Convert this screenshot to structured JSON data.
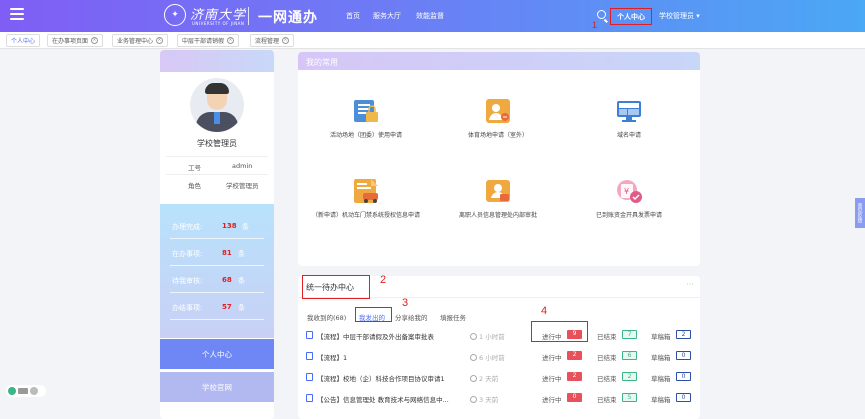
{
  "header": {
    "school_name": "济南大学",
    "school_name_en": "UNIVERSITY OF JINAN",
    "app_title": "一网通办",
    "nav": [
      "首页",
      "服务大厅",
      "效能监督"
    ],
    "personal_center": "个人中心",
    "admin_menu": "学校管理员 ▾",
    "annotation": "1"
  },
  "tabs": [
    "个人中心",
    "在办事项页面",
    "业务管理中心",
    "中层干部请销假",
    "流程管理"
  ],
  "profile": {
    "name": "学校管理员",
    "rows": [
      {
        "label": "工号",
        "value": "admin"
      },
      {
        "label": "角色",
        "value": "学校管理员"
      }
    ],
    "stats": [
      {
        "label": "办理完成:",
        "value": "138",
        "unit": "条"
      },
      {
        "label": "在办事项:",
        "value": "81",
        "unit": "条"
      },
      {
        "label": "待我审核:",
        "value": "68",
        "unit": "条"
      },
      {
        "label": "办结事项:",
        "value": "57",
        "unit": "条"
      }
    ],
    "menu": [
      "个人中心",
      "学校官网"
    ]
  },
  "favorites": {
    "title": "我的常用",
    "apps": [
      {
        "label": "活动场地（团委）使用申请",
        "icon": "building-lock-icon"
      },
      {
        "label": "体育场地申请（室外）",
        "icon": "person-doc-icon"
      },
      {
        "label": "域名申请",
        "icon": "monitor-icon"
      },
      {
        "label": "（新申请）机动车门禁系统授权信息申请",
        "icon": "car-doc-icon"
      },
      {
        "label": "离职人员信息管理处内部审批",
        "icon": "person-card-icon"
      },
      {
        "label": "已到账资金开具发票申请",
        "icon": "invoice-icon"
      }
    ]
  },
  "todo": {
    "title": "统一待办中心",
    "annotation_2": "2",
    "annotation_3": "3",
    "annotation_4": "4",
    "filters": [
      "我收到的(68)",
      "我发出的",
      "分享给我的",
      "填报任务"
    ],
    "rows": [
      {
        "title": "【流程】中层干部请假及外出备案审批表",
        "time": "1 小时前",
        "in_progress": "9",
        "done": "7",
        "draft": "2"
      },
      {
        "title": "【流程】1",
        "time": "6 小时前",
        "in_progress": "2",
        "done": "6",
        "draft": "0"
      },
      {
        "title": "【流程】校地（企）科技合作项目协议审请1",
        "time": "2 天前",
        "in_progress": "2",
        "done": "2",
        "draft": "0"
      },
      {
        "title": "【公告】信息管理处 教育技术与网络信息中...",
        "time": "3 天前",
        "in_progress": "0",
        "done": "5",
        "draft": "0"
      }
    ],
    "labels": {
      "in_progress": "进行中",
      "done": "已结束",
      "draft": "草稿箱"
    }
  },
  "side_float": "意见反馈",
  "colors": {
    "accent": "#4a6cf7",
    "annotation": "#e02020",
    "badge_red": "#e8505b",
    "badge_green": "#3bb58a"
  }
}
